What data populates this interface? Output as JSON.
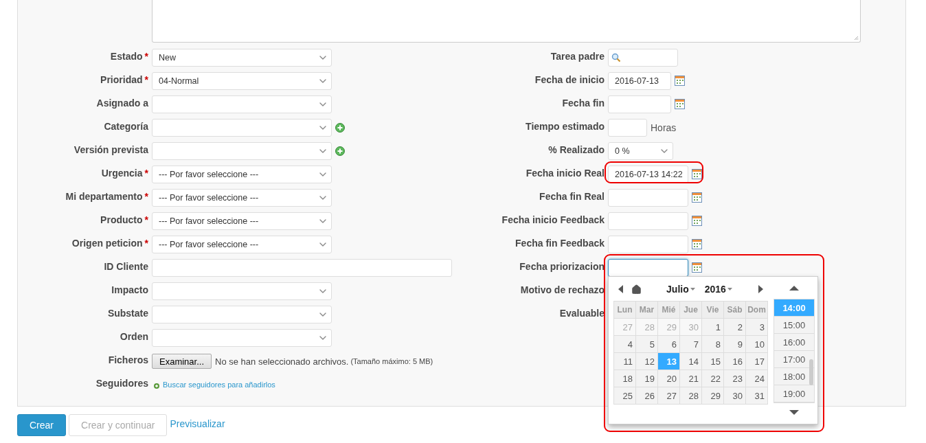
{
  "left_fields": [
    {
      "label": "Estado",
      "required_mark": "*",
      "kind": "select",
      "value": "New"
    },
    {
      "label": "Prioridad",
      "required_mark": "*",
      "kind": "select",
      "value": "04-Normal"
    },
    {
      "label": "Asignado a",
      "kind": "select"
    },
    {
      "label": "Categoría",
      "kind": "select",
      "addable": true
    },
    {
      "label": "Versión prevista",
      "kind": "select",
      "addable": true
    },
    {
      "label": "Urgencia",
      "required_mark": "*",
      "kind": "select",
      "value": "--- Por favor seleccione ---"
    },
    {
      "label": "Mi departamento",
      "required_mark": "*",
      "kind": "select",
      "value": "--- Por favor seleccione ---"
    },
    {
      "label": "Producto",
      "required_mark": "*",
      "kind": "select",
      "value": "--- Por favor seleccione ---"
    },
    {
      "label": "Origen peticion",
      "required_mark": "*",
      "kind": "select",
      "value": "--- Por favor seleccione ---"
    },
    {
      "label": "ID Cliente",
      "kind": "text"
    },
    {
      "label": "Impacto",
      "kind": "select"
    },
    {
      "label": "Substate",
      "kind": "select"
    },
    {
      "label": "Orden",
      "kind": "select"
    },
    {
      "label": "Ficheros",
      "kind": "file",
      "button": "Examinar...",
      "status": "No se han seleccionado archivos.",
      "note": "(Tamaño máximo: 5 MB)"
    },
    {
      "label": "Seguidores",
      "kind": "link",
      "link": "Buscar seguidores para añadirlos"
    }
  ],
  "right_fields": [
    {
      "label": "Tarea padre",
      "kind": "search"
    },
    {
      "label": "Fecha de inicio",
      "kind": "date",
      "value": "2016-07-13"
    },
    {
      "label": "Fecha fin",
      "kind": "date"
    },
    {
      "label": "Tiempo estimado",
      "kind": "number",
      "unit": "Horas"
    },
    {
      "label": "% Realizado",
      "kind": "select",
      "value": "0 %"
    },
    {
      "label": "Fecha inicio Real",
      "kind": "datetime",
      "value": "2016-07-13 14:22",
      "highlighted": true
    },
    {
      "label": "Fecha fin Real",
      "kind": "datetime"
    },
    {
      "label": "Fecha inicio Feedback",
      "kind": "datetime"
    },
    {
      "label": "Fecha fin Feedback",
      "kind": "datetime"
    },
    {
      "label": "Fecha priorizacion",
      "kind": "datetime",
      "focused": true
    },
    {
      "label": "Motivo de rechazo",
      "kind": "covered"
    },
    {
      "label": "Evaluable",
      "kind": "covered"
    }
  ],
  "calendar": {
    "month": "Julio",
    "year": "2016",
    "highlighted": true,
    "weekdays": [
      "Lun",
      "Mar",
      "Mié",
      "Jue",
      "Vie",
      "Sáb",
      "Dom"
    ],
    "weeks": [
      [
        {
          "day": "27",
          "muted": true,
          "selected": false
        },
        {
          "day": "28",
          "muted": true,
          "selected": false
        },
        {
          "day": "29",
          "muted": true,
          "selected": false
        },
        {
          "day": "30",
          "muted": true,
          "selected": false
        },
        {
          "day": "1",
          "muted": false,
          "selected": false
        },
        {
          "day": "2",
          "muted": false,
          "selected": false
        },
        {
          "day": "3",
          "muted": false,
          "selected": false
        }
      ],
      [
        {
          "day": "4",
          "muted": false,
          "selected": false
        },
        {
          "day": "5",
          "muted": false,
          "selected": false
        },
        {
          "day": "6",
          "muted": false,
          "selected": false
        },
        {
          "day": "7",
          "muted": false,
          "selected": false
        },
        {
          "day": "8",
          "muted": false,
          "selected": false
        },
        {
          "day": "9",
          "muted": false,
          "selected": false
        },
        {
          "day": "10",
          "muted": false,
          "selected": false
        }
      ],
      [
        {
          "day": "11",
          "muted": false,
          "selected": false
        },
        {
          "day": "12",
          "muted": false,
          "selected": false
        },
        {
          "day": "13",
          "muted": false,
          "selected": true
        },
        {
          "day": "14",
          "muted": false,
          "selected": false
        },
        {
          "day": "15",
          "muted": false,
          "selected": false
        },
        {
          "day": "16",
          "muted": false,
          "selected": false
        },
        {
          "day": "17",
          "muted": false,
          "selected": false
        }
      ],
      [
        {
          "day": "18",
          "muted": false,
          "selected": false
        },
        {
          "day": "19",
          "muted": false,
          "selected": false
        },
        {
          "day": "20",
          "muted": false,
          "selected": false
        },
        {
          "day": "21",
          "muted": false,
          "selected": false
        },
        {
          "day": "22",
          "muted": false,
          "selected": false
        },
        {
          "day": "23",
          "muted": false,
          "selected": false
        },
        {
          "day": "24",
          "muted": false,
          "selected": false
        }
      ],
      [
        {
          "day": "25",
          "muted": false,
          "selected": false
        },
        {
          "day": "26",
          "muted": false,
          "selected": false
        },
        {
          "day": "27",
          "muted": false,
          "selected": false
        },
        {
          "day": "28",
          "muted": false,
          "selected": false
        },
        {
          "day": "29",
          "muted": false,
          "selected": false
        },
        {
          "day": "30",
          "muted": false,
          "selected": false
        },
        {
          "day": "31",
          "muted": false,
          "selected": false
        }
      ]
    ],
    "times": [
      {
        "label": "14:00",
        "selected": true
      },
      {
        "label": "15:00",
        "selected": false
      },
      {
        "label": "16:00",
        "selected": false
      },
      {
        "label": "17:00",
        "selected": false
      },
      {
        "label": "18:00",
        "selected": false
      },
      {
        "label": "19:00",
        "selected": false
      }
    ]
  },
  "buttons": [
    {
      "label": "Crear",
      "kind": "primary"
    },
    {
      "label": "Crear y continuar",
      "kind": "disabled"
    },
    {
      "label": "Previsualizar",
      "kind": "link"
    }
  ]
}
